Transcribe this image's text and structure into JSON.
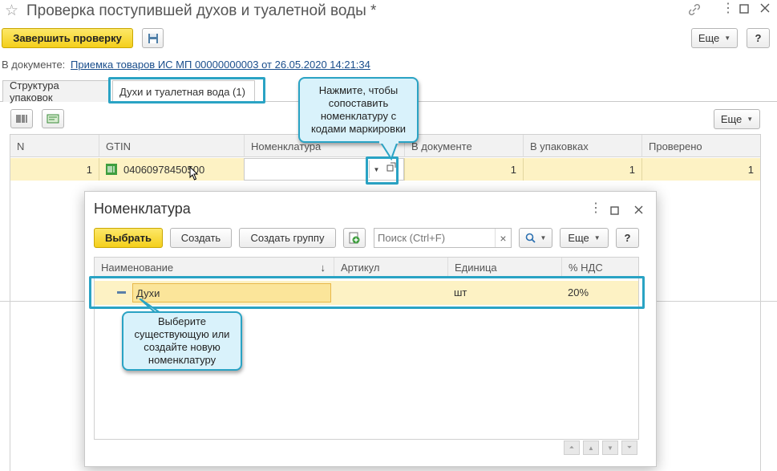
{
  "window": {
    "title": "Проверка поступившей духов и туалетной воды *",
    "star": "☆"
  },
  "toolbar": {
    "finish_label": "Завершить проверку",
    "more_label": "Еще",
    "help_label": "?"
  },
  "document": {
    "label": "В документе:",
    "link": "Приемка товаров ИС МП 00000000003 от 26.05.2020 14:21:34"
  },
  "tabs": [
    {
      "label": "Структура упаковок"
    },
    {
      "label": "Духи и туалетная вода (1)"
    }
  ],
  "grid": {
    "more_label": "Еще",
    "columns": [
      "N",
      "GTIN",
      "Номенклатура",
      "В документе",
      "В упаковках",
      "Проверено"
    ],
    "rows": [
      {
        "n": "1",
        "gtin": "04060978450500",
        "nomenclature": "",
        "in_doc": "1",
        "in_packs": "1",
        "checked": "1"
      }
    ]
  },
  "callouts": {
    "top": "Нажмите, чтобы сопоставить номенклатуру с кодами маркировки",
    "bottom": "Выберите существующую или создайте новую номенклатуру"
  },
  "dialog": {
    "title": "Номенклатура",
    "select_label": "Выбрать",
    "create_label": "Создать",
    "create_group_label": "Создать группу",
    "search_placeholder": "Поиск (Ctrl+F)",
    "clear_label": "×",
    "more_label": "Еще",
    "help_label": "?",
    "columns": [
      "Наименование",
      "Артикул",
      "Единица",
      "% НДС"
    ],
    "sort_arrow": "↓",
    "rows": [
      {
        "name": "Духи",
        "article": "",
        "unit": "шт",
        "vat": "20%"
      }
    ]
  },
  "colors": {
    "accent_yellow": "#f4cf1b",
    "highlight_cyan": "#2aa3c4",
    "row_selected": "#fdf2c4",
    "link": "#1a4e8c"
  }
}
